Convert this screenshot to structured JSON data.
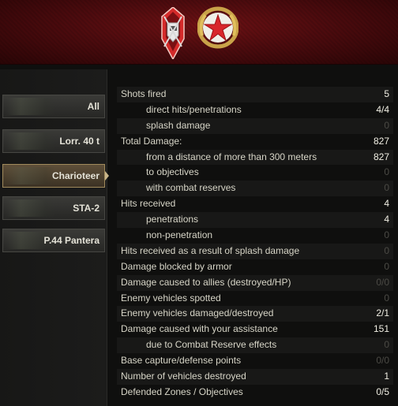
{
  "banner": {
    "medal_left_icon": "guards-shield-medal-icon",
    "medal_right_icon": "red-star-wreath-medal-icon"
  },
  "sidebar": {
    "tabs": [
      {
        "label": "All",
        "icon": "tank-group-icon",
        "selected": false
      },
      {
        "label": "Lorr. 40 t",
        "icon": "tank-icon",
        "selected": false
      },
      {
        "label": "Charioteer",
        "icon": "tank-icon",
        "selected": true
      },
      {
        "label": "STA-2",
        "icon": "tank-icon",
        "selected": false
      },
      {
        "label": "P.44 Pantera",
        "icon": "tank-icon",
        "selected": false
      }
    ]
  },
  "stats": [
    {
      "name": "Shots fired",
      "value": "5",
      "level": 0
    },
    {
      "name": "direct hits/penetrations",
      "value": "4/4",
      "level": 1
    },
    {
      "name": "splash damage",
      "value": "0",
      "level": 1
    },
    {
      "name": "Total Damage:",
      "value": "827",
      "level": 0
    },
    {
      "name": "from a distance of more than 300 meters",
      "value": "827",
      "level": 1
    },
    {
      "name": "to objectives",
      "value": "0",
      "level": 1
    },
    {
      "name": "with combat reserves",
      "value": "0",
      "level": 1
    },
    {
      "name": "Hits received",
      "value": "4",
      "level": 0
    },
    {
      "name": "penetrations",
      "value": "4",
      "level": 1
    },
    {
      "name": "non-penetration",
      "value": "0",
      "level": 1
    },
    {
      "name": "Hits received as a result of splash damage",
      "value": "0",
      "level": 0
    },
    {
      "name": "Damage blocked by armor",
      "value": "0",
      "level": 0
    },
    {
      "name": "Damage caused to allies (destroyed/HP)",
      "value": "0/0",
      "level": 0
    },
    {
      "name": "Enemy vehicles spotted",
      "value": "0",
      "level": 0
    },
    {
      "name": "Enemy vehicles damaged/destroyed",
      "value": "2/1",
      "level": 0
    },
    {
      "name": "Damage caused with your assistance",
      "value": "151",
      "level": 0
    },
    {
      "name": "due to Combat Reserve effects",
      "value": "0",
      "level": 1
    },
    {
      "name": "Base capture/defense points",
      "value": "0/0",
      "level": 0
    },
    {
      "name": "Number of vehicles destroyed",
      "value": "1",
      "level": 0
    },
    {
      "name": "Defended Zones / Objectives",
      "value": "0/5",
      "level": 0
    }
  ]
}
